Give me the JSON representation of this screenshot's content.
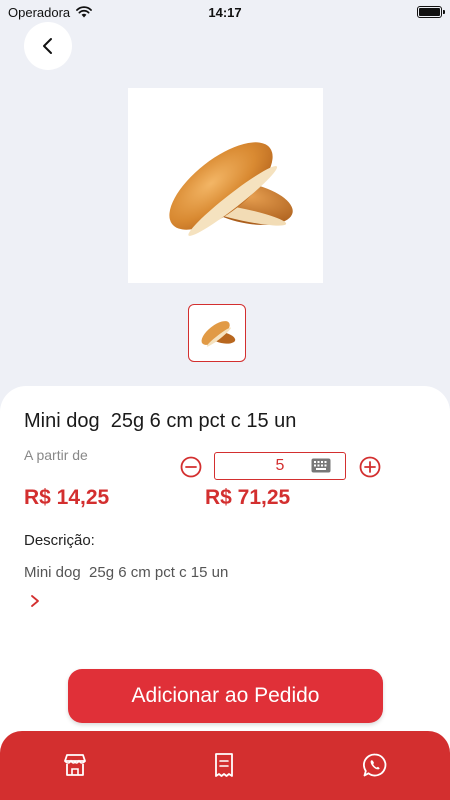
{
  "status_bar": {
    "carrier": "Operadora",
    "time": "14:17"
  },
  "product": {
    "title": "Mini dog  25g 6 cm pct c 15 un",
    "from_label": "A partir de",
    "unit_price": "R$ 14,25",
    "total_price": "R$ 71,25",
    "quantity": "5",
    "description_label": "Descrição:",
    "description_text": "Mini dog  25g 6 cm pct c 15 un"
  },
  "actions": {
    "add_to_order": "Adicionar ao Pedido"
  },
  "colors": {
    "accent": "#d32f2f",
    "button": "#e03038",
    "background": "#eef0f6"
  },
  "icons": {
    "back": "chevron-left-icon",
    "minus": "minus-circle-icon",
    "plus": "plus-circle-icon",
    "keyboard": "keyboard-icon",
    "more": "chevron-right-icon",
    "nav": [
      "store-icon",
      "receipt-icon",
      "whatsapp-icon"
    ]
  }
}
